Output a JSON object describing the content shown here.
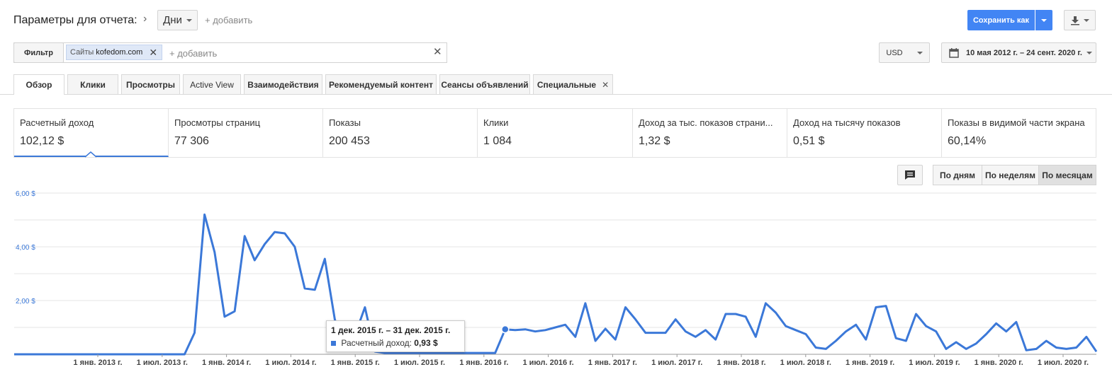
{
  "header": {
    "title": "Параметры для отчета:",
    "dimension": "Дни",
    "add_label": "+ добавить",
    "save_label": "Сохранить как"
  },
  "filter": {
    "button": "Фильтр",
    "chip_prefix": "Сайты",
    "chip_value": "kofedom.com",
    "add_label": "+ добавить"
  },
  "currency": "USD",
  "date_range": "10 мая 2012 г. – 24 сент. 2020 г.",
  "tabs": [
    "Обзор",
    "Клики",
    "Просмотры",
    "Active View",
    "Взаимодействия",
    "Рекомендуемый контент",
    "Сеансы объявлений",
    "Специальные"
  ],
  "metrics": [
    {
      "label": "Расчетный доход",
      "value": "102,12 $"
    },
    {
      "label": "Просмотры страниц",
      "value": "77 306"
    },
    {
      "label": "Показы",
      "value": "200 453"
    },
    {
      "label": "Клики",
      "value": "1 084"
    },
    {
      "label": "Доход за тыс. показов страни...",
      "value": "1,32 $"
    },
    {
      "label": "Доход на тысячу показов",
      "value": "0,51 $"
    },
    {
      "label": "Показы в видимой части экрана",
      "value": "60,14%"
    }
  ],
  "granularity": [
    "По дням",
    "По неделям",
    "По месяцам"
  ],
  "tooltip": {
    "title": "1 дек. 2015 г. – 31 дек. 2015 г.",
    "series": "Расчетный доход:",
    "value": "0,93 $"
  },
  "colors": {
    "accent": "#3b78d8",
    "save_button": "#4285f4"
  },
  "chart_data": {
    "type": "line",
    "ylim": [
      0,
      6
    ],
    "y_ticks": [
      "6,00 $",
      "4,00 $",
      "2,00 $"
    ],
    "x_ticks": [
      "1 янв. 2013 г.",
      "1 июл. 2013 г.",
      "1 янв. 2014 г.",
      "1 июл. 2014 г.",
      "1 янв. 2015 г.",
      "1 июл. 2015 г.",
      "1 янв. 2016 г.",
      "1 июл. 2016 г.",
      "1 янв. 2017 г.",
      "1 июл. 2017 г.",
      "1 янв. 2018 г.",
      "1 июл. 2018 г.",
      "1 янв. 2019 г.",
      "1 июл. 2019 г.",
      "1 янв. 2020 г.",
      "1 июл. 2020 г."
    ],
    "series": [
      {
        "name": "Расчетный доход",
        "values": [
          0,
          0,
          0,
          0,
          0,
          0,
          0,
          0,
          0,
          0,
          0,
          0,
          0,
          0,
          0,
          0,
          0,
          0,
          0.8,
          5.2,
          3.8,
          1.4,
          1.6,
          4.4,
          3.5,
          4.1,
          4.55,
          4.5,
          4.0,
          2.45,
          2.4,
          3.55,
          1.3,
          0.15,
          0.7,
          1.75,
          0.1,
          0.05,
          0.05,
          0.05,
          0.05,
          0.05,
          0.05,
          0.05,
          0.05,
          0.05,
          0.05,
          0.05,
          0.05,
          0.93,
          0.9,
          0.93,
          0.85,
          0.9,
          1.0,
          1.1,
          0.65,
          1.9,
          0.5,
          0.95,
          0.55,
          1.75,
          1.3,
          0.8,
          0.8,
          0.8,
          1.3,
          0.85,
          0.65,
          0.9,
          0.55,
          1.5,
          1.5,
          1.4,
          0.65,
          1.9,
          1.55,
          1.05,
          0.9,
          0.75,
          0.25,
          0.2,
          0.5,
          0.85,
          1.1,
          0.55,
          1.75,
          1.8,
          0.6,
          0.5,
          1.5,
          1.05,
          0.85,
          0.2,
          0.45,
          0.2,
          0.4,
          0.75,
          1.15,
          0.85,
          1.2,
          0.15,
          0.2,
          0.5,
          0.25,
          0.2,
          0.25,
          0.65,
          0.1
        ]
      }
    ]
  }
}
